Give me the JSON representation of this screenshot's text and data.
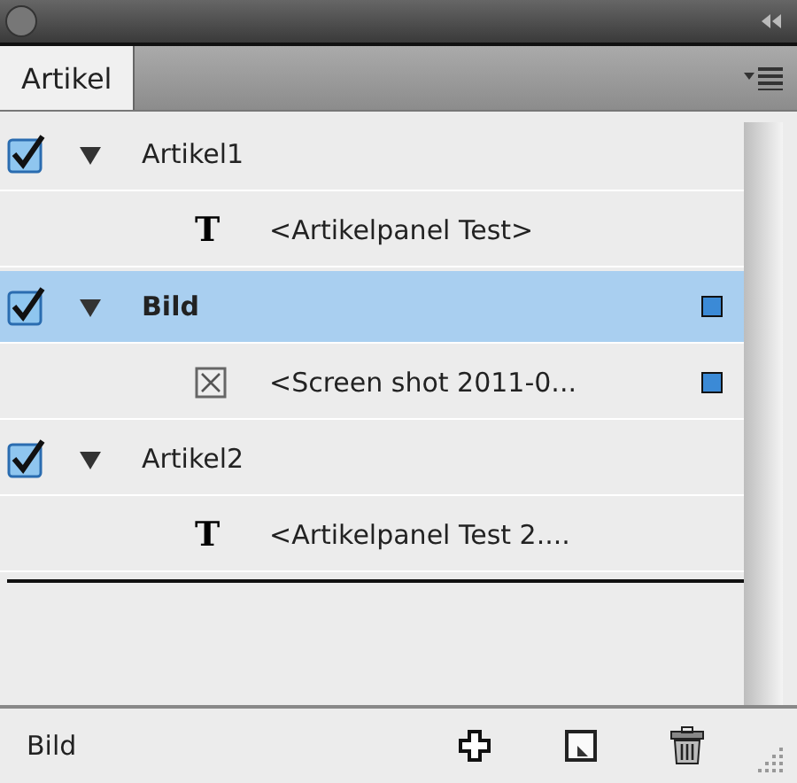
{
  "tabs": [
    {
      "label": "Artikel",
      "selected": true
    }
  ],
  "articles": [
    {
      "name": "Artikel1",
      "checked": true,
      "expanded": true,
      "selected": false,
      "marked": false,
      "children": [
        {
          "kind": "text",
          "glyph": "T",
          "name": "<Artikelpanel Test>",
          "marked": false
        }
      ]
    },
    {
      "name": "Bild",
      "checked": true,
      "expanded": true,
      "selected": true,
      "marked": true,
      "children": [
        {
          "kind": "image",
          "name": "<Screen shot 2011-0...",
          "marked": true
        }
      ]
    },
    {
      "name": "Artikel2",
      "checked": true,
      "expanded": true,
      "selected": false,
      "marked": false,
      "children": [
        {
          "kind": "text",
          "glyph": "T",
          "name": "<Artikelpanel Test 2....",
          "marked": false
        }
      ]
    }
  ],
  "status": "Bild"
}
